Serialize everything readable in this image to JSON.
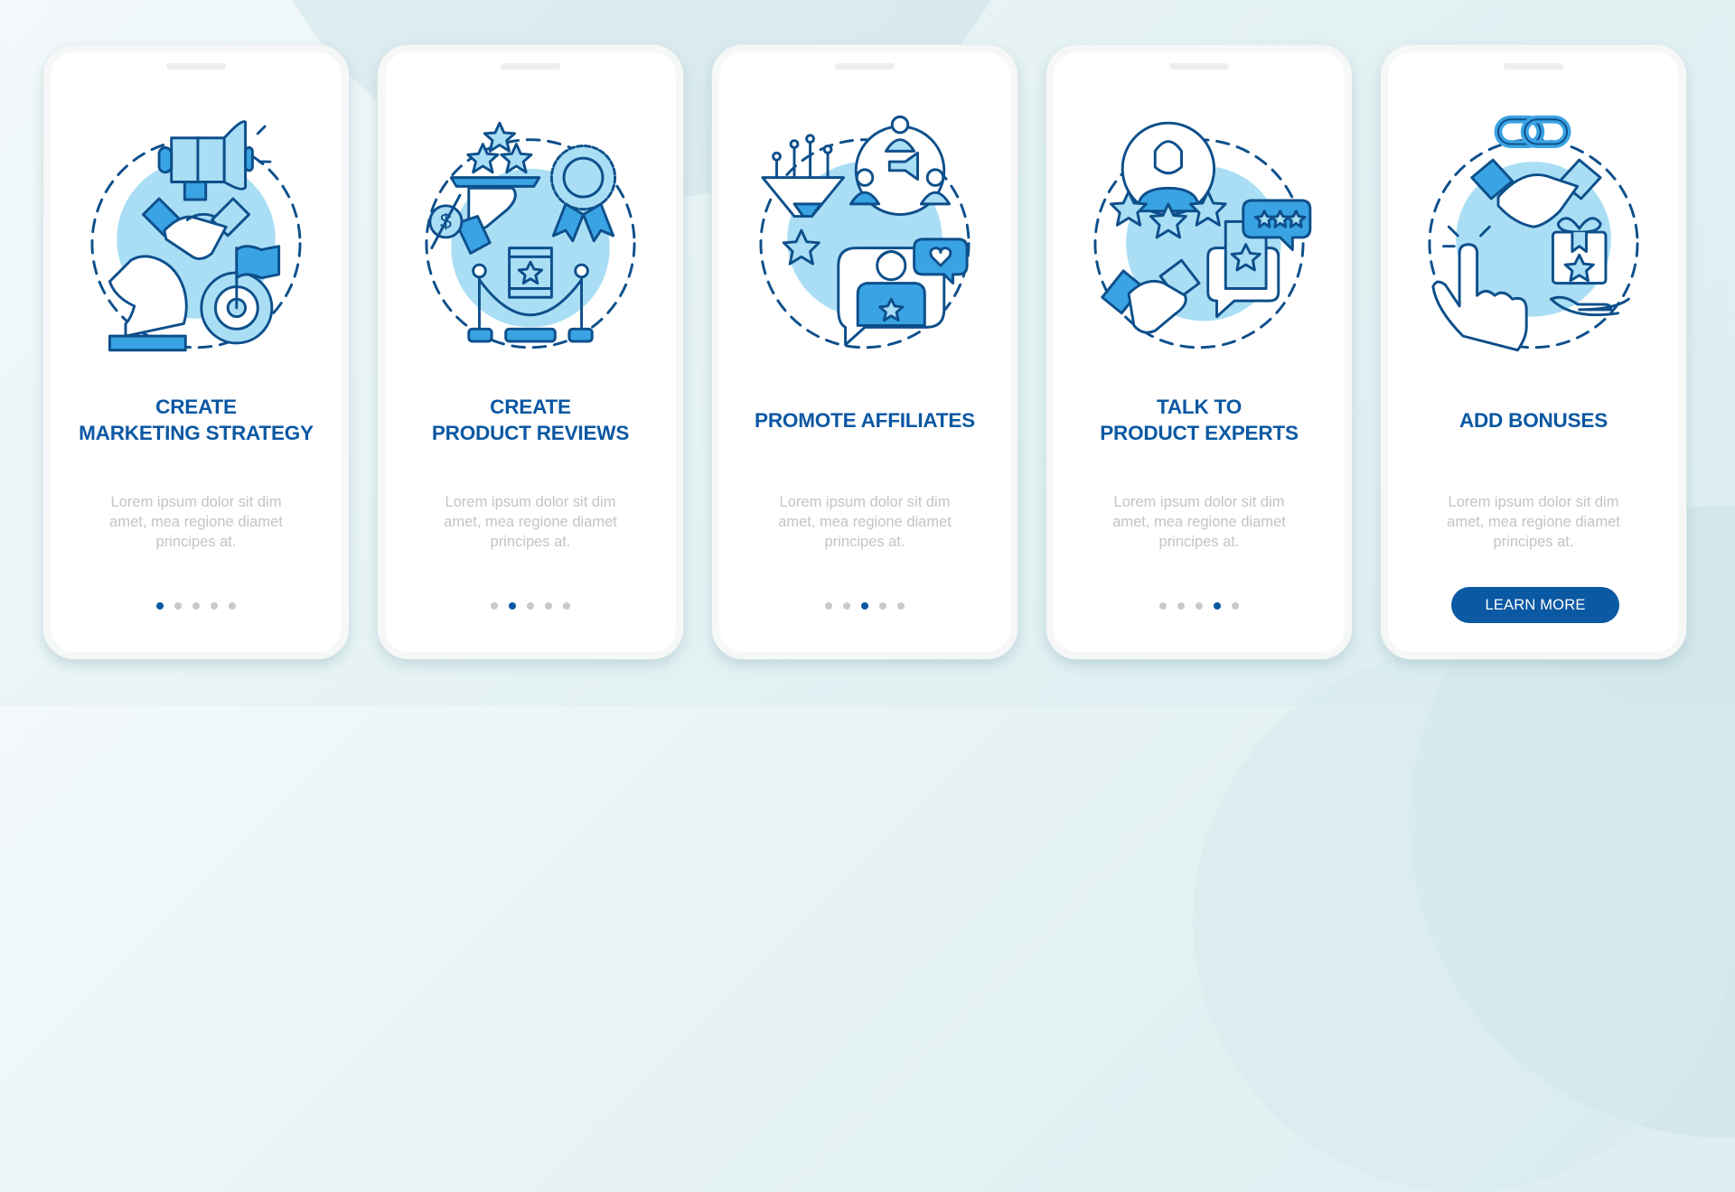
{
  "colors": {
    "accent": "#0b58a3",
    "icon_stroke": "#0d4f8b",
    "icon_fill_light": "#a9def5",
    "icon_fill_mid": "#3aa3e3",
    "circle_bg": "#a9def5",
    "dot_inactive": "#c9c9c9",
    "description_text": "#c4c4c4"
  },
  "screens": [
    {
      "icon": "marketing-strategy-icon",
      "title_lines": [
        "CREATE",
        "MARKETING STRATEGY"
      ],
      "description_lines": [
        "Lorem ipsum dolor sit dim",
        "amet, mea regione diamet",
        "principes at."
      ],
      "active_page": 1,
      "total_pages": 5
    },
    {
      "icon": "product-reviews-icon",
      "title_lines": [
        "CREATE",
        "PRODUCT REVIEWS"
      ],
      "description_lines": [
        "Lorem ipsum dolor sit dim",
        "amet, mea regione diamet",
        "principes at."
      ],
      "active_page": 2,
      "total_pages": 5
    },
    {
      "icon": "promote-affiliates-icon",
      "title_lines": [
        "PROMOTE AFFILIATES"
      ],
      "description_lines": [
        "Lorem ipsum dolor sit dim",
        "amet, mea regione diamet",
        "principes at."
      ],
      "active_page": 3,
      "total_pages": 5
    },
    {
      "icon": "product-experts-icon",
      "title_lines": [
        "TALK TO",
        "PRODUCT EXPERTS"
      ],
      "description_lines": [
        "Lorem ipsum dolor sit dim",
        "amet, mea regione diamet",
        "principes at."
      ],
      "active_page": 4,
      "total_pages": 5
    },
    {
      "icon": "add-bonuses-icon",
      "title_lines": [
        "ADD BONUSES"
      ],
      "description_lines": [
        "Lorem ipsum dolor sit dim",
        "amet, mea regione diamet",
        "principes at."
      ],
      "button_label": "LEARN MORE"
    }
  ]
}
